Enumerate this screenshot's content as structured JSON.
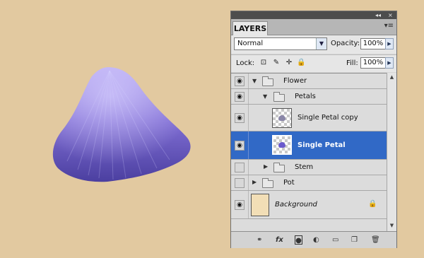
{
  "panel": {
    "title": "LAYERS",
    "topbar_collapse": "◂◂",
    "topbar_close": "×",
    "menu_icon": "panel-menu-icon"
  },
  "blend": {
    "mode": "Normal",
    "opacity_label": "Opacity:",
    "opacity": "100%",
    "fill_label": "Fill:",
    "fill": "100%"
  },
  "lock": {
    "label": "Lock:"
  },
  "layers": [
    {
      "name": "Flower",
      "type": "group",
      "visible": true,
      "expanded": true,
      "indent": 0
    },
    {
      "name": "Petals",
      "type": "group",
      "visible": true,
      "expanded": true,
      "indent": 1
    },
    {
      "name": "Single Petal copy",
      "type": "layer",
      "visible": true,
      "selected": false,
      "thumb_color": "#8a86a8"
    },
    {
      "name": "Single Petal",
      "type": "layer",
      "visible": true,
      "selected": true,
      "thumb_color": "#6a5acd"
    },
    {
      "name": "Stem",
      "type": "group",
      "visible": false,
      "expanded": false,
      "indent": 1
    },
    {
      "name": "Pot",
      "type": "group",
      "visible": false,
      "expanded": false,
      "indent": 0
    },
    {
      "name": "Background",
      "type": "background",
      "visible": true,
      "locked": true
    }
  ],
  "colors": {
    "canvas_bg": "#e2c9a0",
    "selection": "#3169c6",
    "petal_light": "#b3a6ef",
    "petal_dark": "#4a3f9e"
  },
  "footer_icons": [
    "link-icon",
    "fx-icon",
    "mask-icon",
    "adjustment-icon",
    "new-group-icon",
    "new-layer-icon",
    "trash-icon"
  ]
}
